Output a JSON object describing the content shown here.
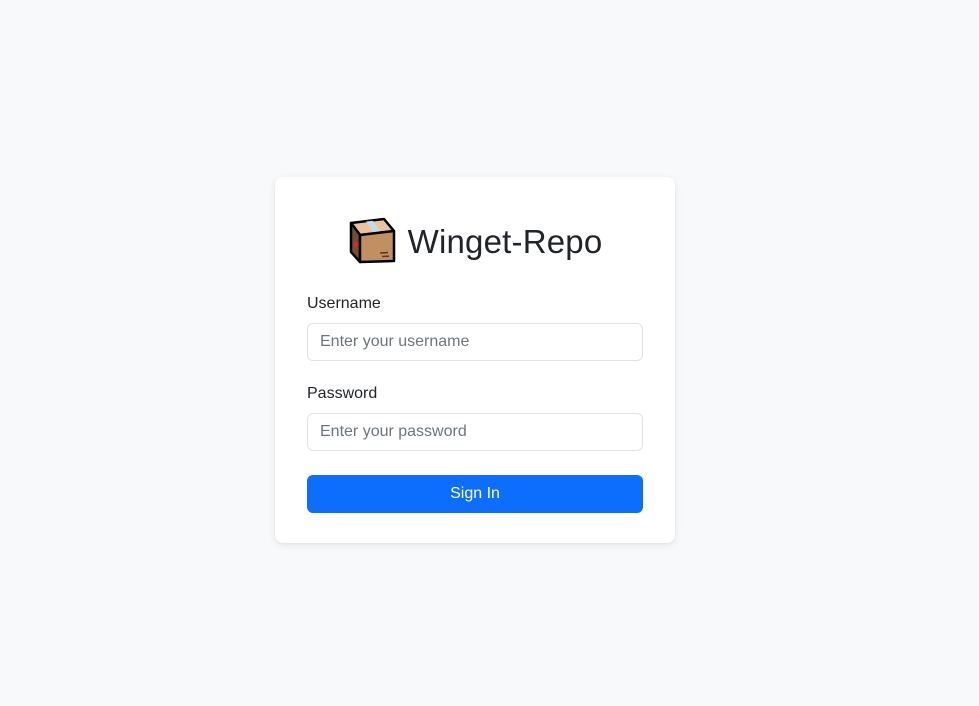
{
  "app": {
    "title": "Winget-Repo",
    "logo_icon": "package-box-icon"
  },
  "form": {
    "username": {
      "label": "Username",
      "placeholder": "Enter your username",
      "value": ""
    },
    "password": {
      "label": "Password",
      "placeholder": "Enter your password",
      "value": ""
    },
    "submit_label": "Sign In"
  },
  "colors": {
    "background": "#f8f9fa",
    "card": "#ffffff",
    "primary": "#0d6efd",
    "text": "#212529",
    "placeholder": "#6c757d",
    "border": "#dee2e6"
  }
}
